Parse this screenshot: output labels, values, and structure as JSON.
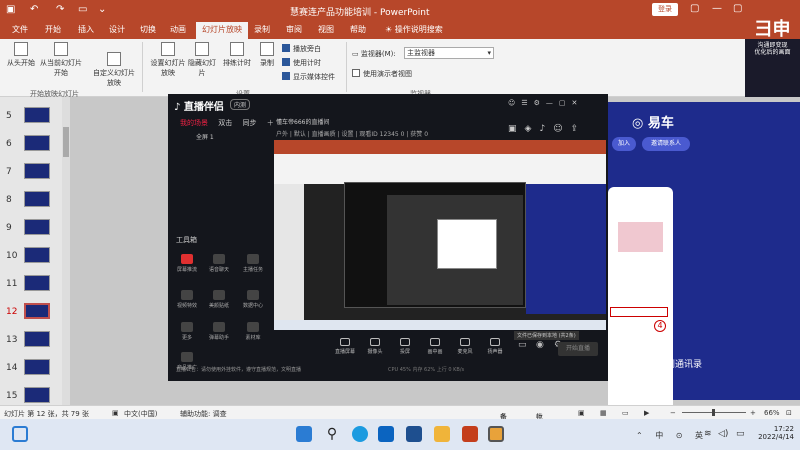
{
  "titlebar": {
    "doc_title": "慧赛连产品功能培训 - PowerPoint",
    "login_label": "登录"
  },
  "ribbon_tabs": [
    "文件",
    "开始",
    "插入",
    "设计",
    "切换",
    "动画",
    "幻灯片放映",
    "录制",
    "审阅",
    "视图",
    "帮助"
  ],
  "ribbon_search": "操作说明搜索",
  "ribbon": {
    "btn_from_start": "从头开始",
    "btn_from_current": "从当前幻灯片开始",
    "btn_custom": "自定义幻灯片放映",
    "group_start": "开始放映幻灯片",
    "btn_setup": "设置幻灯片放映",
    "btn_hide": "隐藏幻灯片",
    "btn_rehearse": "排练计时",
    "btn_record": "录制",
    "group_setup": "设置",
    "chk_narration": "播放旁白",
    "chk_timing": "使用计时",
    "chk_media": "显示媒体控件",
    "monitor_label": "监视器(M):",
    "monitor_value": "主监视器",
    "chk_presenter": "使用演示者视图",
    "group_monitor": "监视器"
  },
  "brand_logo": {
    "big": "彐申",
    "small": "沟通即变现",
    "cam": "优化后的画面"
  },
  "slide_pane": {
    "items": [
      {
        "num": "5"
      },
      {
        "num": "6"
      },
      {
        "num": "7"
      },
      {
        "num": "8"
      },
      {
        "num": "9"
      },
      {
        "num": "10"
      },
      {
        "num": "11"
      },
      {
        "num": "12"
      },
      {
        "num": "13"
      },
      {
        "num": "14"
      },
      {
        "num": "15"
      }
    ],
    "current": "12"
  },
  "slide_right": {
    "brand": "易车",
    "btn1": "加入",
    "btn2": "邀请联系人",
    "caption": "点击添加到通讯录",
    "badge": "4"
  },
  "stream_app": {
    "logo": "直播伴侣",
    "version": "内测",
    "tabs": [
      "我的场景",
      "双击",
      "同步"
    ],
    "source": "全屏 1",
    "room_title": "懂车帝666的直播间",
    "room_meta": "户外  |  默认 | 直播画质 | 设置 | 观看ID 12345 0 | 获赞 0",
    "toolbox_label": "工具箱",
    "tools": [
      "屏幕推流",
      "语音聊天",
      "主播任务",
      "视频特效",
      "美颜贴纸",
      "数据中心",
      "更多",
      "弹幕助手",
      "素材库",
      "商品推广"
    ],
    "bottom_tools": [
      "直播屏幕",
      "摄像头",
      "投屏",
      "画中画",
      "麦克风",
      "扬声器"
    ],
    "golive": "开始直播",
    "notice": "文件已保存到本地 (共2条)",
    "footer": "直播公告：请勿使用外挂软件，遵守直播规范，文明直播",
    "footer2": "CPU 45%   内存 62%   上行 0 KB/s"
  },
  "statusbar": {
    "slide_info": "幻灯片 第 12 张，共 79 张",
    "lang": "中文(中国)",
    "accessibility": "辅助功能: 调查",
    "notes": "备注",
    "comments": "批注",
    "zoom": "66%"
  },
  "taskbar": {
    "time": "17:22",
    "date": "2022/4/14",
    "tray": "⌃ 中 ⊙ 英"
  },
  "colors": {
    "ppt_red": "#b7472a",
    "slide_blue": "#1e2b8c",
    "stream_bg": "#14161c"
  }
}
